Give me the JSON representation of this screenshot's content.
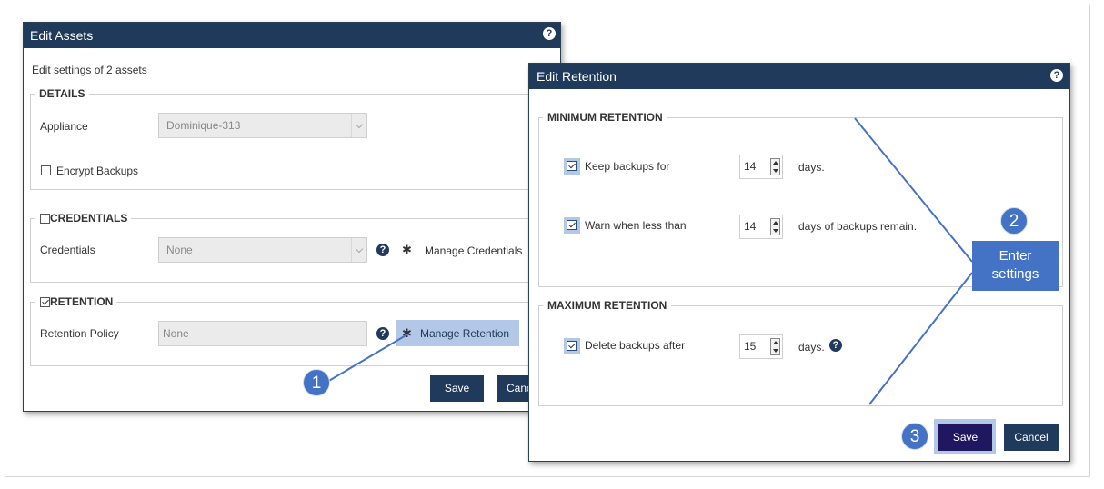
{
  "edit_assets": {
    "title": "Edit Assets",
    "subtitle": "Edit settings of 2 assets",
    "details": {
      "legend": "DETAILS",
      "appliance_label": "Appliance",
      "appliance_value": "Dominique-313",
      "encrypt_label": "Encrypt Backups",
      "encrypt_checked": false
    },
    "credentials": {
      "legend": "CREDENTIALS",
      "checked": false,
      "credentials_label": "Credentials",
      "credentials_value": "None",
      "manage_label": "Manage Credentials"
    },
    "retention": {
      "legend": "RETENTION",
      "checked": true,
      "policy_label": "Retention Policy",
      "policy_value": "None",
      "manage_label": "Manage Retention"
    },
    "save_label": "Save",
    "cancel_label": "Cancel"
  },
  "edit_retention": {
    "title": "Edit Retention",
    "minimum": {
      "legend": "MINIMUM RETENTION",
      "keep_label": "Keep backups for",
      "keep_value": "14",
      "keep_suffix": "days.",
      "warn_label": "Warn when less than",
      "warn_value": "14",
      "warn_suffix": "days of backups remain."
    },
    "maximum": {
      "legend": "MAXIMUM RETENTION",
      "delete_label": "Delete backups after",
      "delete_value": "15",
      "delete_suffix": "days."
    },
    "save_label": "Save",
    "cancel_label": "Cancel"
  },
  "annotations": {
    "step1": "1",
    "step2": "2",
    "step3": "3",
    "callout_line1": "Enter",
    "callout_line2": "settings"
  },
  "icons": {
    "help": "?",
    "gear": "✱"
  },
  "colors": {
    "titlebar": "#1f3a5b",
    "button": "#1f3a5b",
    "annotation": "#4472c4",
    "highlight": "#b3c7e6"
  }
}
